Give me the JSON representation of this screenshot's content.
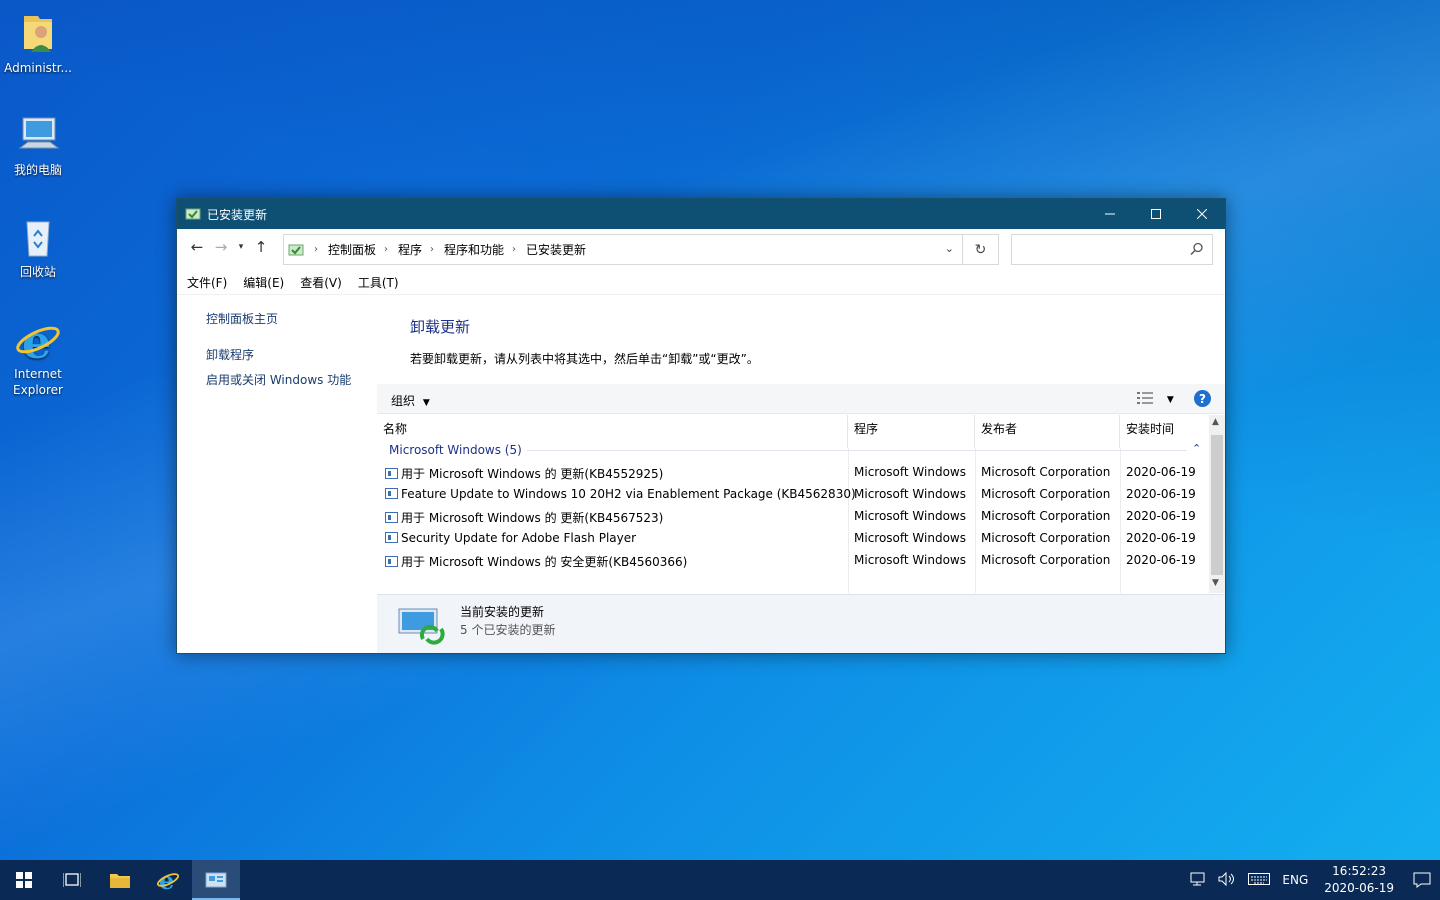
{
  "desktop": {
    "icons": [
      {
        "label": "Administr..."
      },
      {
        "label": "我的电脑"
      },
      {
        "label": "回收站"
      },
      {
        "label": "Internet Explorer"
      }
    ]
  },
  "window": {
    "title": "已安装更新",
    "address": {
      "crumbs": [
        "控制面板",
        "程序",
        "程序和功能",
        "已安装更新"
      ]
    },
    "search_placeholder": "",
    "menu": [
      "文件(F)",
      "编辑(E)",
      "查看(V)",
      "工具(T)"
    ],
    "left_links": [
      "控制面板主页",
      "卸载程序",
      "启用或关闭 Windows 功能"
    ],
    "heading": "卸载更新",
    "description": "若要卸载更新，请从列表中将其选中，然后单击“卸载”或“更改”。",
    "toolbar": {
      "organize": "组织"
    },
    "columns": [
      "名称",
      "程序",
      "发布者",
      "安装时间"
    ],
    "group": "Microsoft Windows (5)",
    "rows": [
      {
        "name": "用于 Microsoft Windows 的 更新(KB4552925)",
        "program": "Microsoft Windows",
        "publisher": "Microsoft Corporation",
        "date": "2020-06-19"
      },
      {
        "name": "Feature Update to Windows 10 20H2 via Enablement Package (KB4562830)",
        "program": "Microsoft Windows",
        "publisher": "Microsoft Corporation",
        "date": "2020-06-19"
      },
      {
        "name": "用于 Microsoft Windows 的 更新(KB4567523)",
        "program": "Microsoft Windows",
        "publisher": "Microsoft Corporation",
        "date": "2020-06-19"
      },
      {
        "name": "Security Update for Adobe Flash Player",
        "program": "Microsoft Windows",
        "publisher": "Microsoft Corporation",
        "date": "2020-06-19"
      },
      {
        "name": "用于 Microsoft Windows 的 安全更新(KB4560366)",
        "program": "Microsoft Windows",
        "publisher": "Microsoft Corporation",
        "date": "2020-06-19"
      }
    ],
    "details": {
      "line1": "当前安装的更新",
      "line2": "5 个已安装的更新"
    }
  },
  "taskbar": {
    "language": "ENG",
    "time": "16:52:23",
    "date": "2020-06-19"
  },
  "colors": {
    "titlebar": "#0e4f74",
    "taskbar": "#0a2a55",
    "link": "#1e3287"
  }
}
